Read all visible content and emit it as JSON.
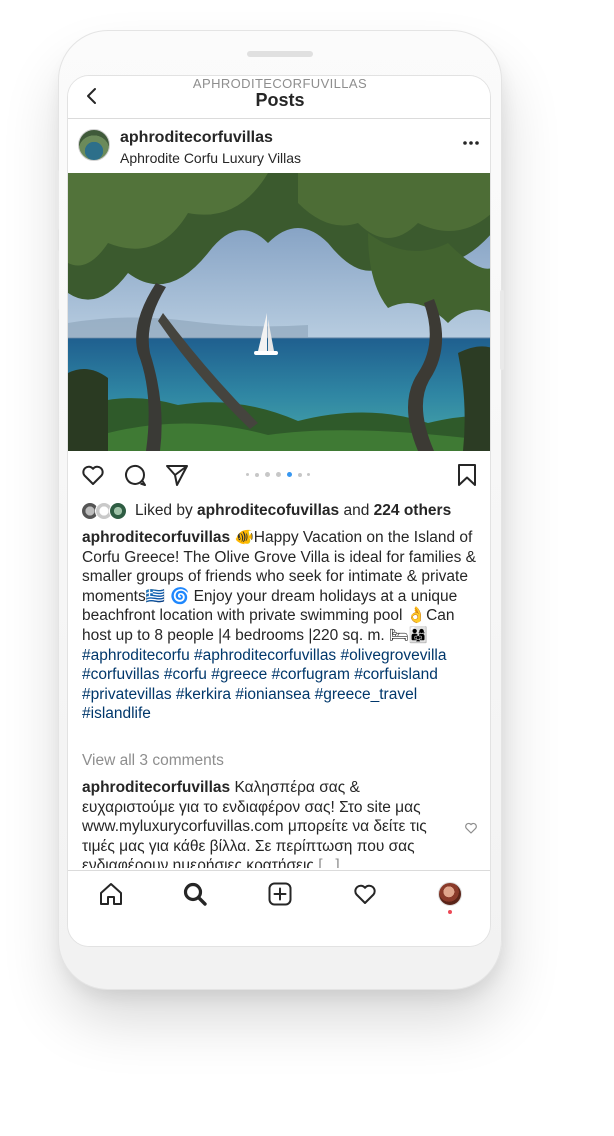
{
  "nav": {
    "account": "APHRODITECORFUVILLAS",
    "title": "Posts"
  },
  "post": {
    "username": "aphroditecorfuvillas",
    "location": "Aphrodite Corfu Luxury Villas",
    "carousel": {
      "count": 6,
      "active_index": 4
    },
    "likes": {
      "prefix": "Liked by ",
      "user": "aphroditecofuvillas",
      "middle": " and ",
      "others": "224 others"
    },
    "caption": {
      "username": "aphroditecorfuvillas",
      "text_1": " ",
      "emoji_1": "🐠",
      "text_2": "Happy Vacation on the Island of Corfu Greece! The Olive Grove Villa is ideal for families & smaller groups of friends who seek for intimate & private moments",
      "emoji_2": "🇬🇷 🌀",
      "text_3": " Enjoy your dream holidays at a unique beachfront location with private swimming pool ",
      "emoji_3": "👌",
      "text_4": "Can host up to 8 people |4 bedrooms |220 sq. m. ",
      "emoji_4": "🛏👨‍👩‍👧",
      "hashtags": "#aphroditecorfu #aphroditecorfuvillas #olivegrovevilla #corfuvillas #corfu #greece #corfugram #corfuisland #privatevillas #kerkira #ioniansea #greece_travel #islandlife"
    },
    "view_comments": "View all 3 comments",
    "comment": {
      "username": "aphroditecorfuvillas",
      "text": " Καλησπέρα σας & ευχαριστούμε για το ενδιαφέρον σας! Στο site μας www.myluxurycorfuvillas.com μπορείτε να δείτε τις τιμές μας για κάθε βίλλα. Σε περίπτωση που σας ενδιαφέρουν ημερήσιες κρατήσεις",
      "more": "[...]"
    }
  },
  "icons": {
    "back": "chevron-left-icon",
    "more": "more-dots-icon",
    "like": "heart-icon",
    "comment": "comment-bubble-icon",
    "share": "paper-plane-icon",
    "save": "bookmark-icon",
    "home": "home-icon",
    "search": "search-icon",
    "add": "add-post-icon",
    "activity": "heart-icon",
    "profile": "profile-avatar"
  },
  "colors": {
    "text": "#262626",
    "secondary": "#8e8e8e",
    "hashtag": "#00376b",
    "active_dot": "#3897f0",
    "notification": "#ed4956"
  }
}
